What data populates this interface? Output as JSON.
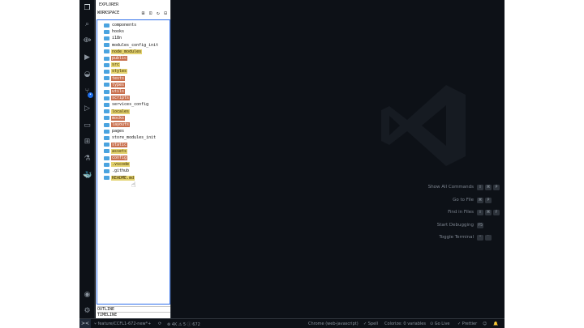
{
  "sidebar": {
    "header": "EXPLORER",
    "section": "WORKSPACE",
    "section_icons": "⊞ ⊡ ↻ ⊟",
    "tree": [
      {
        "label": "components",
        "style": "plain"
      },
      {
        "label": "hooks",
        "style": "plain"
      },
      {
        "label": "i18n",
        "style": "plain"
      },
      {
        "label": "modules_config_init",
        "style": "plain"
      },
      {
        "label": "node_modules",
        "style": "yellow"
      },
      {
        "label": "public",
        "style": "red"
      },
      {
        "label": "src",
        "style": "yellow"
      },
      {
        "label": "styles",
        "style": "yellow"
      },
      {
        "label": "tests",
        "style": "red"
      },
      {
        "label": "types",
        "style": "red"
      },
      {
        "label": "utils",
        "style": "red"
      },
      {
        "label": "scripts",
        "style": "red"
      },
      {
        "label": "services_config",
        "style": "plain"
      },
      {
        "label": "locales",
        "style": "yellow"
      },
      {
        "label": "mocks",
        "style": "red"
      },
      {
        "label": "layouts",
        "style": "red"
      },
      {
        "label": "pages",
        "style": "plain"
      },
      {
        "label": "store_modules_init",
        "style": "plain"
      },
      {
        "label": "static",
        "style": "red"
      },
      {
        "label": "assets",
        "style": "yellow"
      },
      {
        "label": "config",
        "style": "red"
      },
      {
        "label": ".vscode",
        "style": "yellow"
      },
      {
        "label": ".github",
        "style": "plain"
      },
      {
        "label": "README.md",
        "style": "yellow"
      }
    ],
    "outline": "OUTLINE",
    "timeline": "TIMELINE"
  },
  "shortcuts": [
    {
      "label": "Show All Commands",
      "keys": [
        "⇧",
        "⌘",
        "P"
      ]
    },
    {
      "label": "Go to File",
      "keys": [
        "⌘",
        "P"
      ]
    },
    {
      "label": "Find in Files",
      "keys": [
        "⇧",
        "⌘",
        "F"
      ]
    },
    {
      "label": "Start Debugging",
      "keys": [
        "F5"
      ]
    },
    {
      "label": "Toggle Terminal",
      "keys": [
        "⌃",
        "`"
      ]
    }
  ],
  "statusbar": {
    "remote": "><",
    "branch": "feature/CCFL1-672-new*+",
    "sync": "⟳",
    "problems": "⊗ 4K  ⚠ 5  ⓘ 672",
    "debug_target": "Chrome (web-javascript)",
    "spell": "✓ Spell",
    "colorize": "Colorize: 0 variables",
    "golive": "⊙ Go Live",
    "prettier": "✓ Prettier",
    "feedback": "☺",
    "bell": "🔔"
  },
  "colors": {
    "editor_bg": "#0d1117",
    "accent": "#1f6feb",
    "folder": "#4aa3df"
  }
}
